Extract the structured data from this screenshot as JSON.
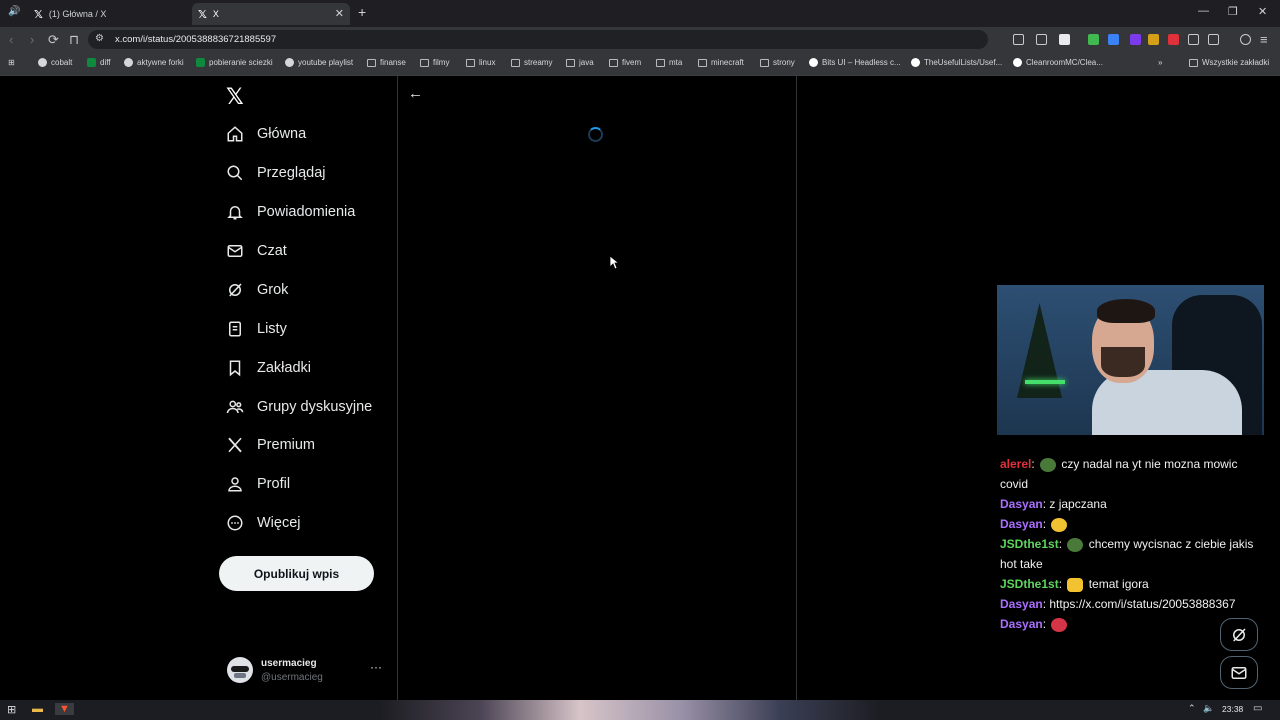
{
  "browser": {
    "tabs": [
      {
        "title": "(1) Główna / X",
        "active": false
      },
      {
        "title": "X",
        "active": true
      }
    ],
    "url": "x.com/i/status/2005388836721885597",
    "bookmarks": [
      "cobalt",
      "diff",
      "aktywne forki",
      "pobieranie sciezki",
      "youtube playlist",
      "finanse",
      "filmy",
      "linux",
      "streamy",
      "java",
      "fivem",
      "mta",
      "minecraft",
      "strony",
      "Bits UI – Headless c...",
      "TheUsefulLists/Usef...",
      "CleanroomMC/Clea..."
    ],
    "all_bookmarks_label": "Wszystkie zakładki"
  },
  "sidebar": {
    "items": [
      {
        "label": "Główna",
        "icon": "home-icon"
      },
      {
        "label": "Przeglądaj",
        "icon": "search-icon"
      },
      {
        "label": "Powiadomienia",
        "icon": "bell-icon"
      },
      {
        "label": "Czat",
        "icon": "mail-icon"
      },
      {
        "label": "Grok",
        "icon": "grok-icon"
      },
      {
        "label": "Listy",
        "icon": "list-icon"
      },
      {
        "label": "Zakładki",
        "icon": "bookmark-icon"
      },
      {
        "label": "Grupy dyskusyjne",
        "icon": "communities-icon"
      },
      {
        "label": "Premium",
        "icon": "x-icon"
      },
      {
        "label": "Profil",
        "icon": "person-icon"
      },
      {
        "label": "Więcej",
        "icon": "more-circle-icon"
      }
    ],
    "post_button": "Opublikuj wpis",
    "account": {
      "name": "usermacieg",
      "handle": "@usermacieg",
      "more": "···"
    }
  },
  "chat": {
    "messages": [
      {
        "user": "alerel",
        "color": "#e0303a",
        "text": "czy nadal na yt nie mozna mowic covid",
        "emote": true
      },
      {
        "user": "Dasyan",
        "color": "#a970ff",
        "text": "z japczana",
        "emote": false
      },
      {
        "user": "Dasyan",
        "color": "#a970ff",
        "text": "",
        "emote": true
      },
      {
        "user": "JSDthe1st",
        "color": "#5fd35f",
        "text": "chcemy wycisnac z ciebie jakis hot take",
        "emote": true
      },
      {
        "user": "JSDthe1st",
        "color": "#5fd35f",
        "text": "temat igora",
        "emote": true
      },
      {
        "user": "Dasyan",
        "color": "#a970ff",
        "text": "https://x.com/i/status/20053888367",
        "emote": false
      },
      {
        "user": "Dasyan",
        "color": "#a970ff",
        "text": "",
        "emote": true
      }
    ]
  },
  "taskbar": {
    "time": "23:38"
  }
}
